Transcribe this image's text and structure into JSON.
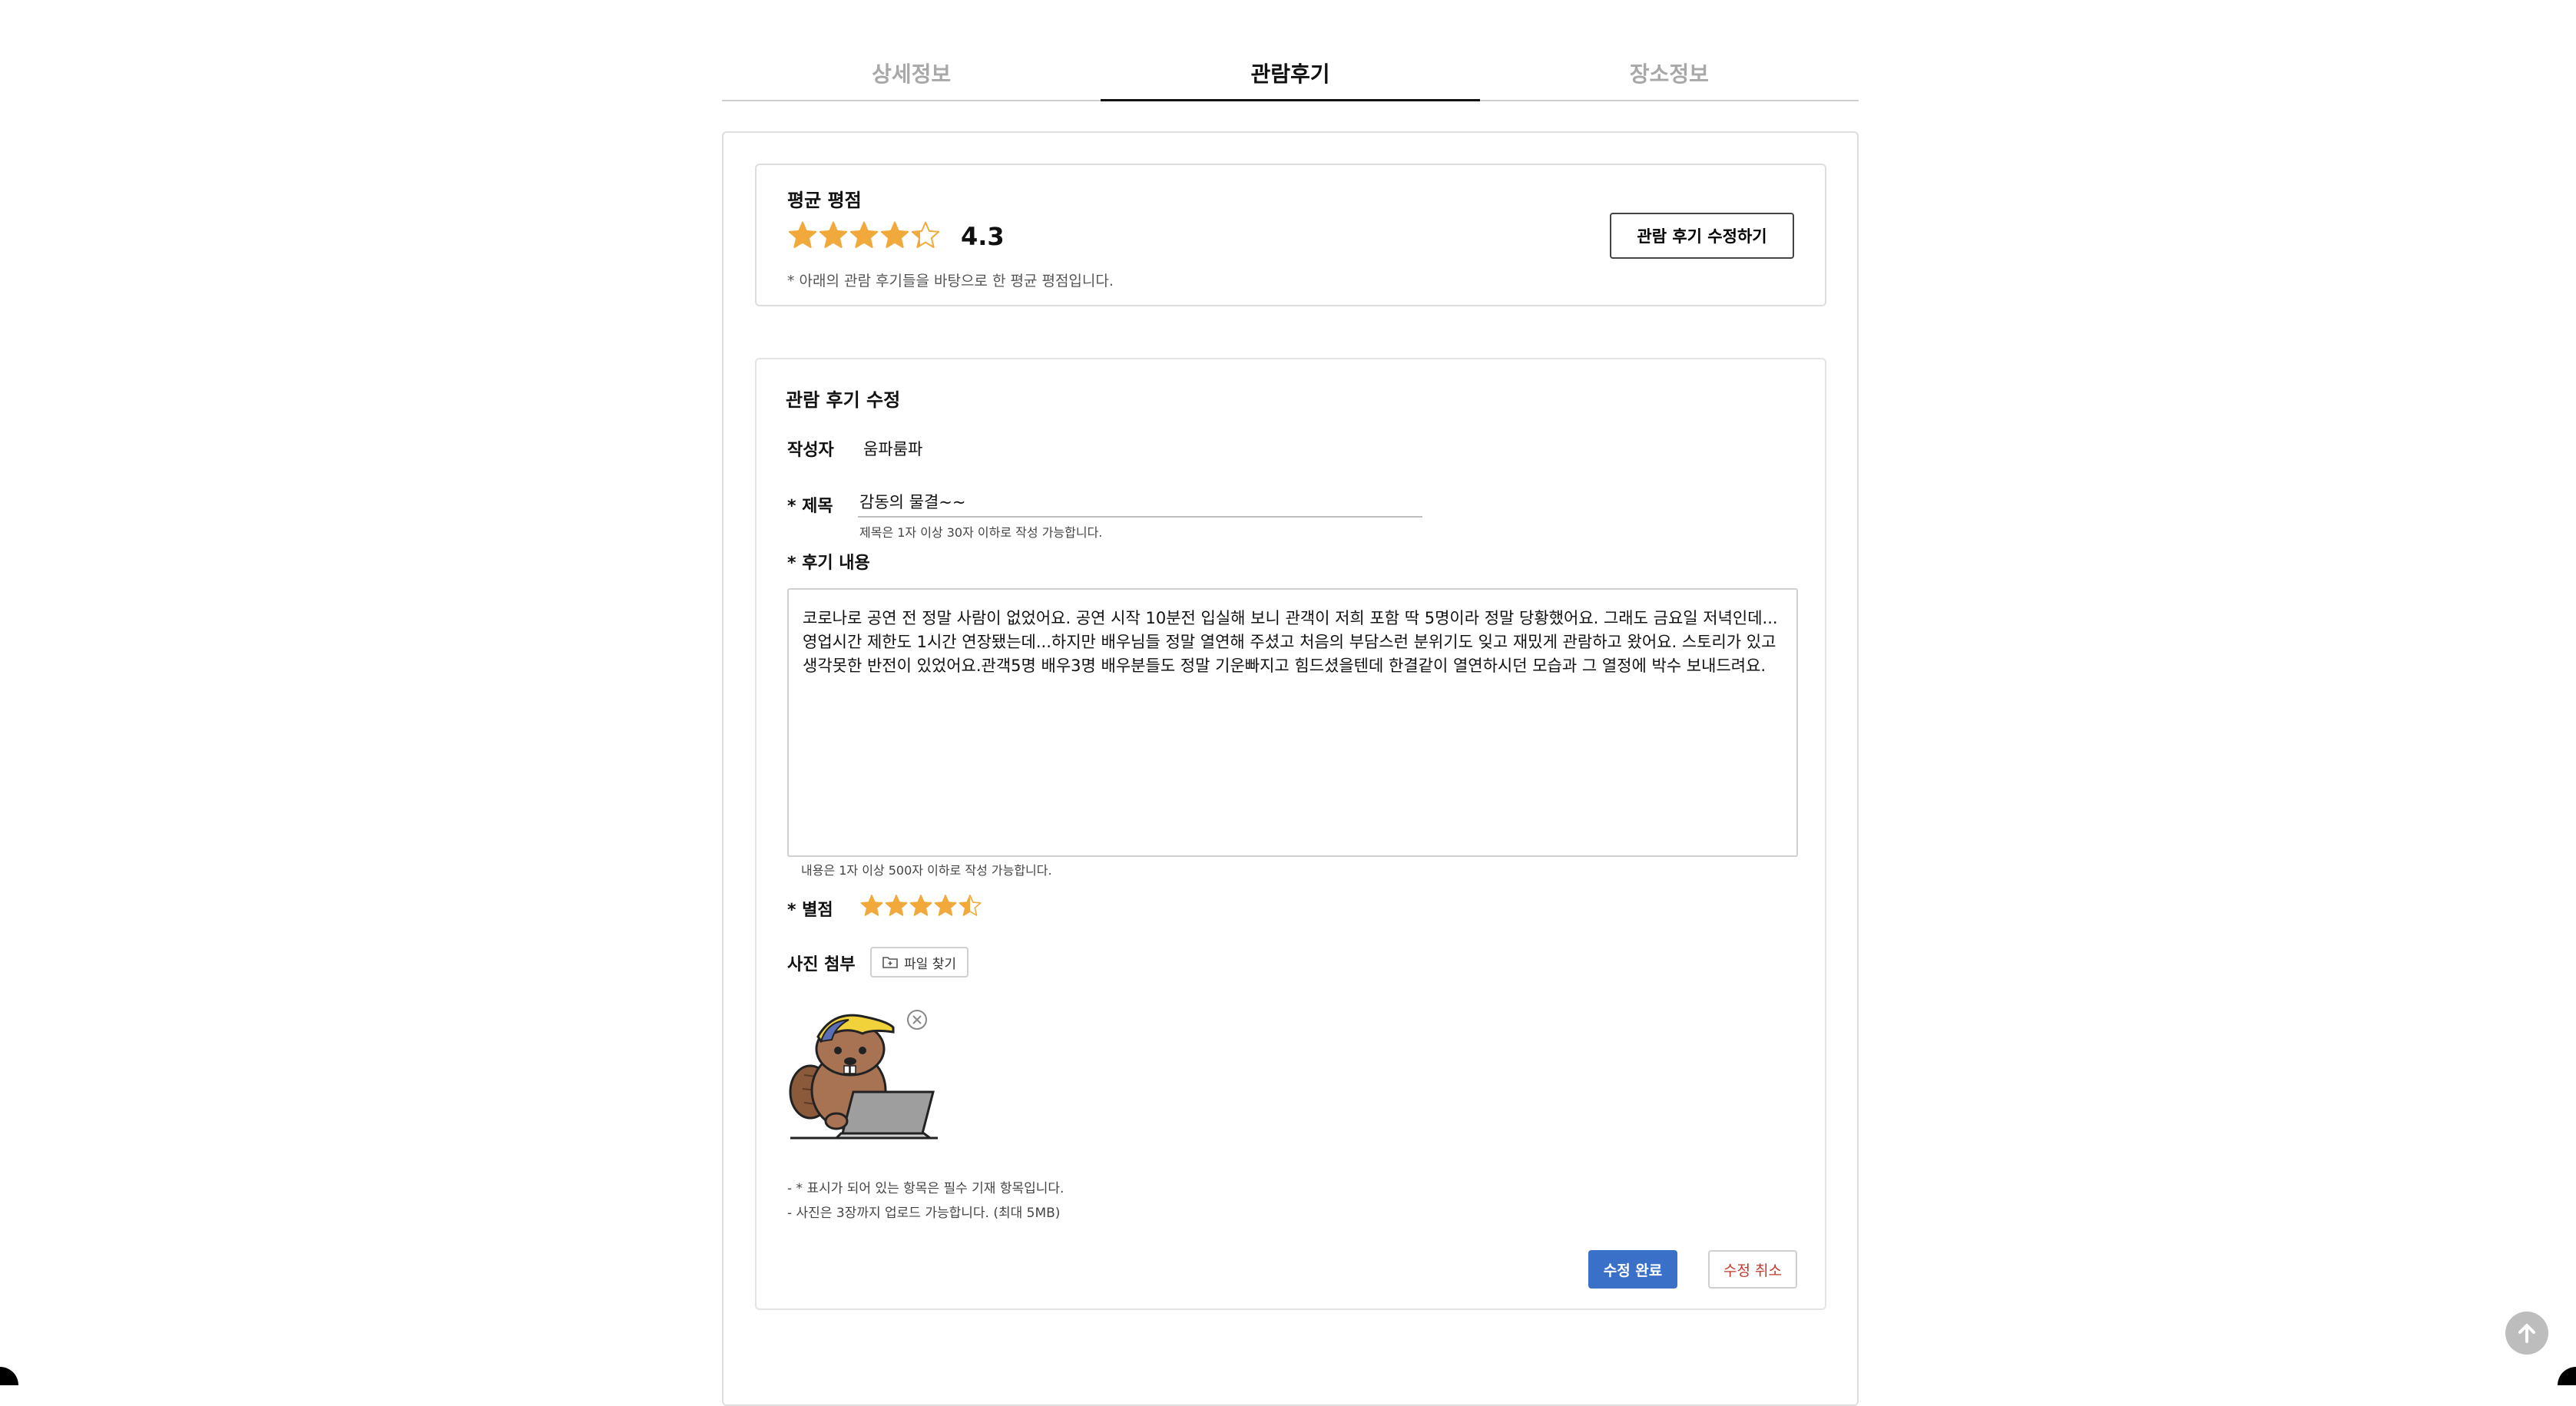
{
  "tabs": [
    {
      "label": "상세정보",
      "active": false
    },
    {
      "label": "관람후기",
      "active": true
    },
    {
      "label": "장소정보",
      "active": false
    }
  ],
  "average": {
    "title": "평균 평점",
    "score": "4.3",
    "rating_value": 4.3,
    "rating_max": 5,
    "note": "* 아래의 관람 후기들을 바탕으로 한 평균 평점입니다.",
    "edit_button": "관람 후기 수정하기"
  },
  "form": {
    "title": "관람 후기 수정",
    "author_label": "작성자",
    "author_value": "움파룸파",
    "title_label": "* 제목",
    "title_value": "감동의 물결~~",
    "title_hint": "제목은 1자 이상 30자 이하로 작성 가능합니다.",
    "content_label": "* 후기 내용",
    "content_value": "코로나로 공연 전 정말 사람이 없었어요. 공연 시작 10분전 입실해 보니 관객이 저희 포함 딱 5명이라 정말 당황했어요. 그래도 금요일 저녁인데... 영업시간 제한도 1시간 연장됐는데...하지만 배우님들 정말 열연해 주셨고 처음의 부담스런 분위기도 잊고 재밌게 관람하고 왔어요. 스토리가 있고 생각못한 반전이 있었어요.관객5명 배우3명 배우분들도 정말 기운빠지고 힘드셨을텐데 한결같이 열연하시던 모습과 그 열정에 박수 보내드려요.",
    "content_hint": "내용은 1자 이상 500자 이하로 작성 가능합니다.",
    "rating_label": "* 별점",
    "rating_value": 4.5,
    "rating_max": 5,
    "photo_label": "사진 첨부",
    "file_button": "파일 찾기",
    "notes": [
      "- * 표시가 되어 있는 항목은 필수 기재 항목입니다.",
      "- 사진은 3장까지 업로드 가능합니다. (최대 5MB)"
    ],
    "submit_label": "수정 완료",
    "cancel_label": "수정 취소"
  },
  "colors": {
    "star": "#f2a93b",
    "star_empty": "#d9d9d9",
    "primary": "#3a70c7",
    "cancel_text": "#c0392b"
  },
  "icons": {
    "star": "star-icon",
    "folder": "folder-plus-icon",
    "remove": "close-circle-icon",
    "scroll_top": "arrow-up-icon"
  }
}
